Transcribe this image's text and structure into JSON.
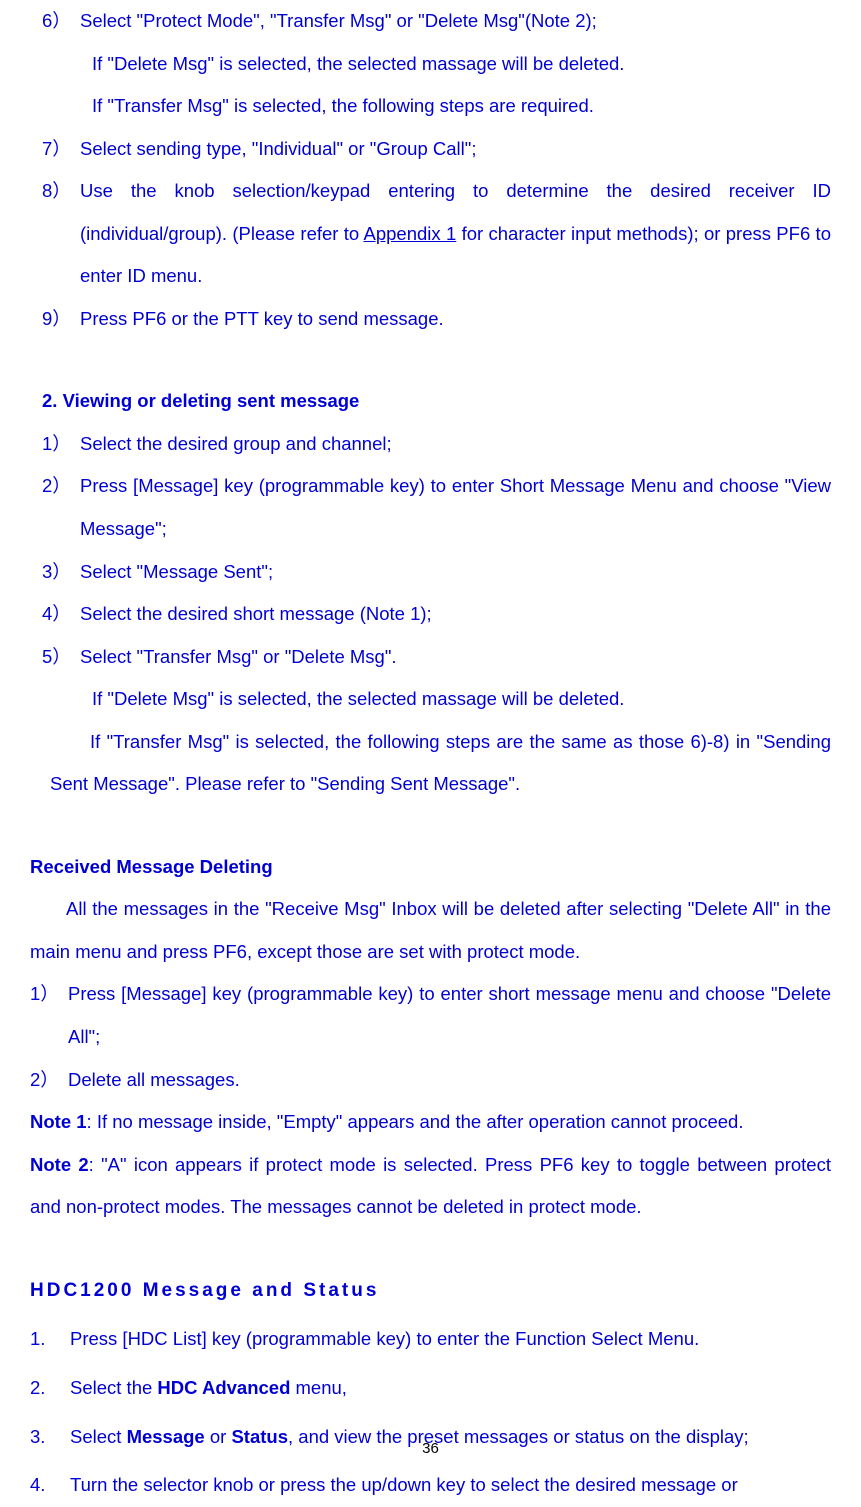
{
  "list1": {
    "item6": {
      "num": "6）",
      "text": "Select \"Protect Mode\", \"Transfer Msg\" or \"Delete Msg\"(Note 2);",
      "sub1": "If \"Delete Msg\" is selected, the selected massage will be deleted.",
      "sub2": "If \"Transfer Msg\" is selected, the following steps are required."
    },
    "item7": {
      "num": "7）",
      "text": "Select sending type, \"Individual\" or \"Group Call\";"
    },
    "item8": {
      "num": "8）",
      "text_pre": "Use the knob selection/keypad entering to determine the desired receiver ID (individual/group). (Please refer to ",
      "text_link": "Appendix 1",
      "text_post": " for character input methods); or press PF6 to enter ID menu."
    },
    "item9": {
      "num": "9）",
      "text": "Press PF6 or the PTT key to send message."
    }
  },
  "section2": {
    "heading": "2.    Viewing or deleting sent message",
    "item1": {
      "num": "1）",
      "text": "Select the desired group and channel;"
    },
    "item2": {
      "num": "2）",
      "text": "Press [Message] key (programmable key) to enter Short Message Menu and choose \"View Message\";"
    },
    "item3": {
      "num": "3）",
      "text": "Select \"Message Sent\";"
    },
    "item4": {
      "num": "4）",
      "text": "Select the desired short message (Note 1);"
    },
    "item5": {
      "num": "5）",
      "text": "Select \"Transfer Msg\" or \"Delete Msg\".",
      "sub1": "If \"Delete Msg\" is selected, the selected massage will be deleted."
    },
    "tail": "  If \"Transfer Msg\" is selected, the following steps are the same as those 6)-8) in \"Sending Sent Message\". Please refer to \"Sending Sent Message\"."
  },
  "received": {
    "heading": "Received Message Deleting",
    "para": "All the messages in the \"Receive Msg\" Inbox will be deleted after selecting \"Delete All\" in the main menu and press PF6, except those are set with protect mode.",
    "item1": {
      "num": "1）",
      "text": "Press [Message] key (programmable key) to enter short message menu and choose \"Delete All\";"
    },
    "item2": {
      "num": "2）",
      "text": "Delete all messages."
    },
    "note1_label": "Note 1",
    "note1_text": ": If no message inside, \"Empty\" appears and the after operation cannot proceed.",
    "note2_label": "Note 2",
    "note2_text": ": \"A\" icon appears if protect mode is selected. Press PF6 key to toggle between protect and non-protect modes. The messages cannot be deleted in protect mode."
  },
  "hdc": {
    "heading": "HDC1200 Message and Status",
    "item1": {
      "num": "1.",
      "text": "Press [HDC List] key (programmable key) to enter the Function Select Menu."
    },
    "item2": {
      "num": "2.",
      "pre": "Select the ",
      "bold": "HDC Advanced",
      "post": " menu,"
    },
    "item3": {
      "num": "3.",
      "pre": "Select ",
      "bold1": "Message",
      "mid": " or ",
      "bold2": "Status",
      "post": ", and view the preset messages or status on the display;"
    },
    "item4": {
      "num": "4.",
      "text": "Turn the selector knob or press the up/down key to select the desired message or"
    }
  },
  "page_num": "36"
}
